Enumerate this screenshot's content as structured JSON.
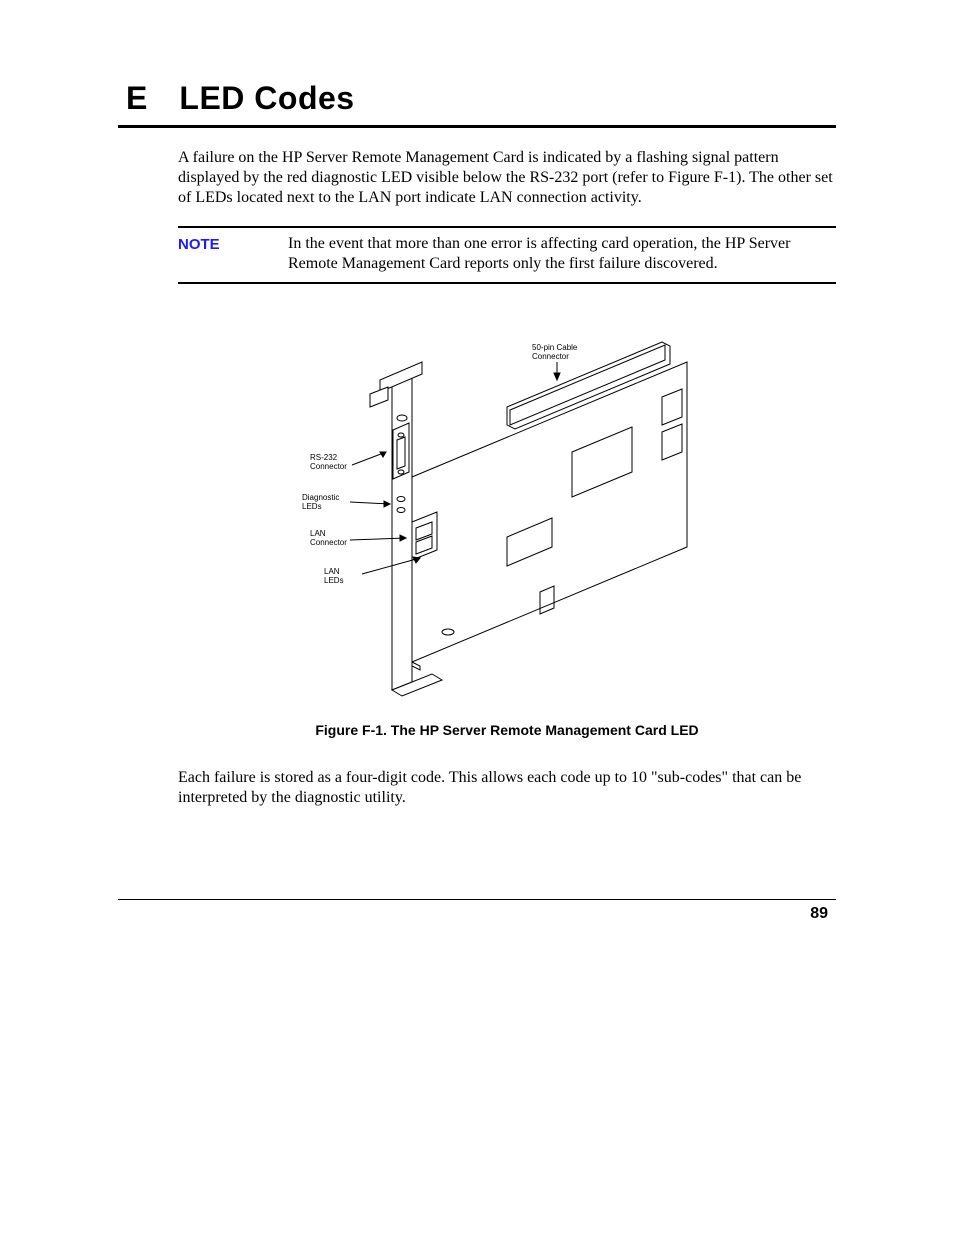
{
  "chapter": {
    "letter": "E",
    "title": "LED Codes"
  },
  "paragraph1": "A failure on the HP Server Remote Management Card is indicated by a flashing signal pattern displayed by the red diagnostic LED visible below the RS-232 port (refer to Figure F-1). The other set of LEDs located next to the LAN port indicate LAN connection activity.",
  "note": {
    "label": "NOTE",
    "text": "In the event that more than one error is affecting card operation, the HP Server Remote Management Card reports only the first failure discovered."
  },
  "figure": {
    "caption": "Figure F-1. The HP Server Remote Management Card LED",
    "labels": {
      "cable": "50-pin Cable\nConnector",
      "rs232": "RS-232\nConnector",
      "diag": "Diagnostic\nLEDs",
      "lanconn": "LAN\nConnector",
      "lanled": "LAN\nLEDs"
    }
  },
  "paragraph2": "Each failure is stored as a four-digit code. This allows each code up to 10 \"sub-codes\" that can be interpreted by the diagnostic utility.",
  "page_number": "89"
}
